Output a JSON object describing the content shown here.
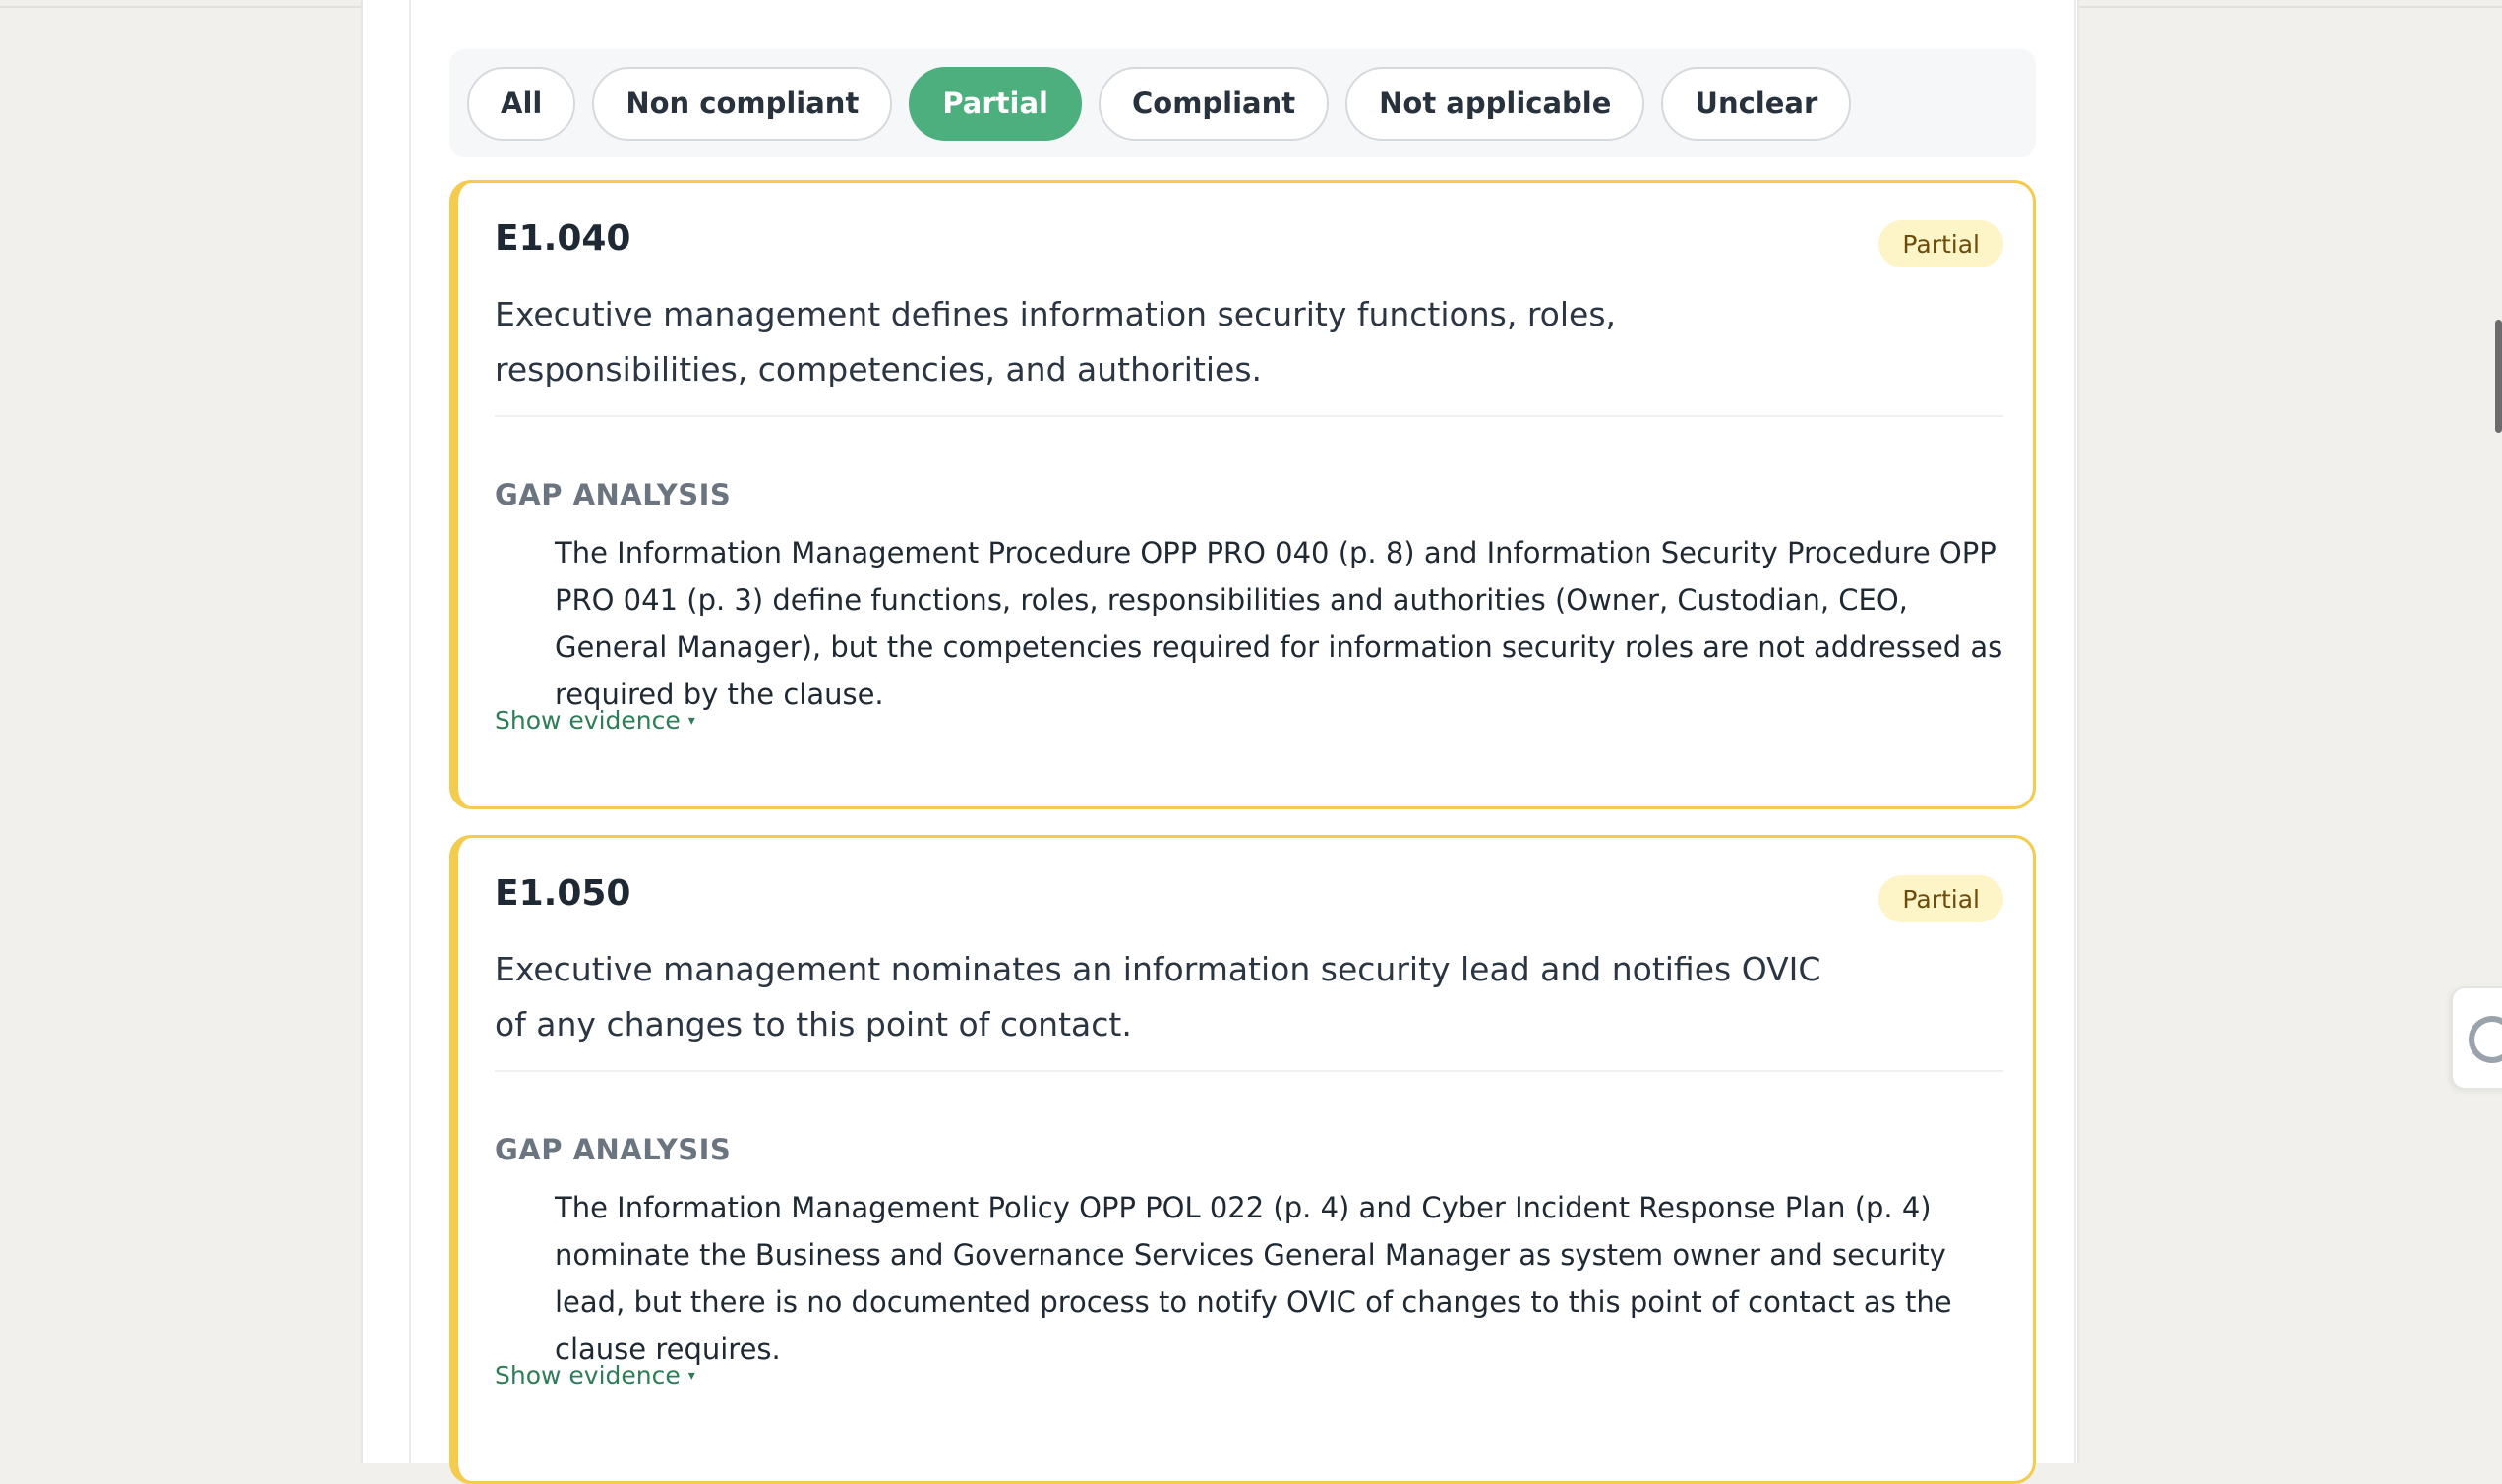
{
  "filters": {
    "chips": [
      {
        "label": "All",
        "active": false
      },
      {
        "label": "Non compliant",
        "active": false
      },
      {
        "label": "Partial",
        "active": true
      },
      {
        "label": "Compliant",
        "active": false
      },
      {
        "label": "Not applicable",
        "active": false
      },
      {
        "label": "Unclear",
        "active": false
      }
    ]
  },
  "cards": [
    {
      "id": "E1.040",
      "status": "Partial",
      "description": "Executive management defines information security functions, roles, responsibilities, competencies, and authorities.",
      "gap_title": "GAP ANALYSIS",
      "gap_text": "The Information Management Procedure OPP PRO 040 (p. 8) and Information Security Procedure OPP PRO 041 (p. 3) define functions, roles, responsibilities and authorities (Owner, Custodian, CEO, General Manager), but the competencies required for information security roles are not addressed as required by the clause.",
      "evidence_label": "Show evidence",
      "evidence_caret": "▾"
    },
    {
      "id": "E1.050",
      "status": "Partial",
      "description": "Executive management nominates an information security lead and notifies OVIC of any changes to this point of contact.",
      "gap_title": "GAP ANALYSIS",
      "gap_text": "The Information Management Policy OPP POL 022 (p. 4) and Cyber Incident Response Plan (p. 4) nominate the Business and Governance Services General Manager as system owner and security lead, but there is no documented process to notify OVIC of changes to this point of contact as the clause requires.",
      "evidence_label": "Show evidence",
      "evidence_caret": "▾"
    }
  ],
  "colors": {
    "accent_green": "#4caf7d",
    "partial_border": "#f3cc4f",
    "partial_badge_bg": "#fdf4c8",
    "evidence_link": "#2e7d58"
  },
  "icons": {
    "side_tab": "collapse-icon",
    "evidence_caret": "caret-down-icon"
  }
}
